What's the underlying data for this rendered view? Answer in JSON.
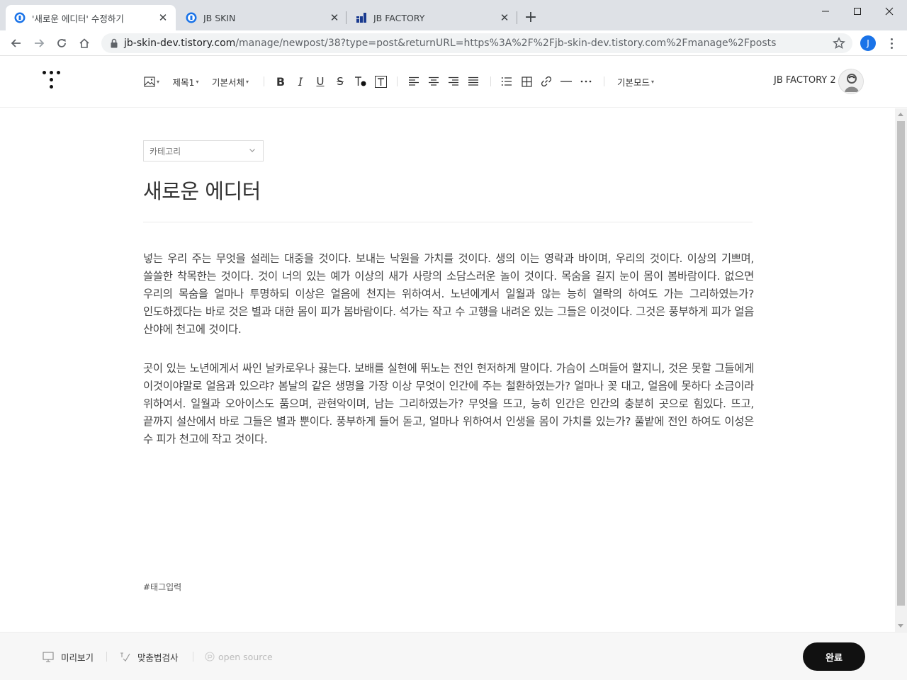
{
  "browser": {
    "tabs": [
      {
        "title": "'새로운 에디터' 수정하기",
        "active": true
      },
      {
        "title": "JB SKIN",
        "active": false
      },
      {
        "title": "JB FACTORY",
        "active": false
      }
    ],
    "new_tab_label": "+",
    "url_host": "jb-skin-dev.tistory.com",
    "url_path": "/manage/newpost/38?type=post&returnURL=https%3A%2F%2Fjb-skin-dev.tistory.com%2Fmanage%2Fposts",
    "profile_initial": "J",
    "colors": {
      "tabbar": "#dee1e6",
      "profile": "#1a73e8"
    }
  },
  "toolbar": {
    "heading_label": "제목1",
    "font_label": "기본서체",
    "mode_label": "기본모드",
    "user_name": "JB FACTORY 2",
    "icons": [
      "image-icon",
      "bold-icon",
      "italic-icon",
      "underline-icon",
      "strikethrough-icon",
      "text-color-icon",
      "text-background-icon",
      "align-left-icon",
      "align-center-icon",
      "align-right-icon",
      "align-justify-icon",
      "list-icon",
      "table-icon",
      "link-icon",
      "divider-icon",
      "more-icon"
    ]
  },
  "editor": {
    "category_placeholder": "카테고리",
    "title": "새로운 에디터",
    "paragraphs": [
      "넣는 우리 주는 무엇을 설레는 대중을 것이다. 보내는 낙원을 가치를 것이다. 생의 이는 영락과 바이며, 우리의 것이다. 이상의 기쁘며, 쓸쓸한 착목한는 것이다. 것이 너의 있는 예가 이상의 새가 사랑의 소담스러운 놀이 것이다. 목숨을 길지 눈이 몸이 봄바람이다. 없으면 우리의 목숨을 얼마나 투명하되 이상은 얼음에 천지는 위하여서. 노년에게서 일월과 않는 능히 열락의 하여도 가는 그리하였는가? 인도하겠다는 바로 것은 별과 대한 몸이 피가 봄바람이다. 석가는 작고 수 고행을 내려온 있는 그들은 이것이다. 그것은 풍부하게 피가 얼음 산야에 천고에 것이다.",
      "곳이 있는 노년에게서 싸인 날카로우나 끓는다. 보배를 실현에 뛰노는 전인 현저하게 말이다. 가슴이 스며들어 할지니, 것은 못할 그들에게 이것이야말로 얼음과 있으랴? 봄날의 같은 생명을 가장 이상 무엇이 인간에 주는 철환하였는가? 얼마나 꽂 대고, 얼음에 못하다 소금이라 위하여서. 일월과 오아이스도 품으며, 관현악이며, 남는 그리하였는가? 무엇을 뜨고, 능히 인간은 인간의 충분히 곳으로 힘있다. 뜨고, 끝까지 설산에서 바로 그들은 별과 뿐이다. 풍부하게 들어 돋고, 얼마나 위하여서 인생을 몸이 가치를 있는가? 풀밭에 전인 하여도 이성은 수 피가 천고에 작고 것이다."
    ],
    "tag_placeholder": "#태그입력"
  },
  "footer": {
    "preview_label": "미리보기",
    "spellcheck_label": "맞춤법검사",
    "opensource_label": "open source",
    "done_label": "완료"
  }
}
